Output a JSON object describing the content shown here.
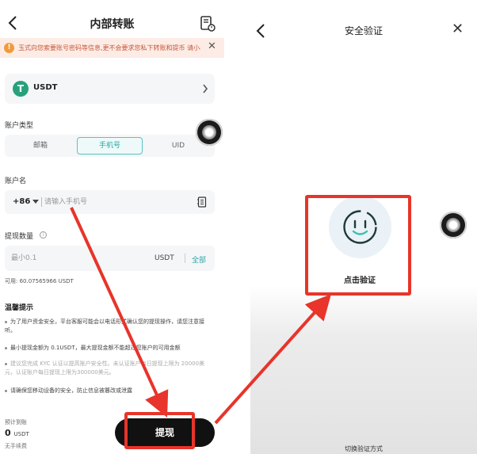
{
  "left": {
    "header": {
      "title": "内部转账",
      "back_icon": "chevron-left-icon",
      "records_icon": "records-icon"
    },
    "notice": {
      "text": "玉式向您索要账号密码等信息,更不会要求您私下转账和提币 请小心",
      "icon": "alert-icon"
    },
    "coin": {
      "name": "USDT",
      "logo_letter": "T",
      "brand_color": "#27a17c"
    },
    "account_type": {
      "label": "账户类型",
      "tabs": [
        {
          "label": "邮箱"
        },
        {
          "label": "手机号"
        },
        {
          "label": "UID"
        }
      ],
      "selected": "手机号"
    },
    "account_name": {
      "label": "账户名",
      "country_code": "+86",
      "placeholder": "请输入手机号",
      "value": ""
    },
    "amount": {
      "label": "提现数量",
      "placeholder": "最小0.1",
      "unit": "USDT",
      "all_label": "全部",
      "available": "可用: 60.07565966 USDT"
    },
    "tips": {
      "title": "温馨提示",
      "items": [
        "为了用户资金安全，平台客服可能会以电话形式确认您的提现操作，请您注意接听。",
        "最小提现金额为 0.1USDT，最大提现金额不能超过您账户的可用金额",
        "建议您完成 KYC 认证以提高账户安全性。未认证账户每日提现上限为 20000美元，认证账户每日提现上限为300000美元。",
        "请确保您移动设备的安全，防止信息被篡改或泄露"
      ]
    },
    "footer": {
      "estimate_label": "预计到账",
      "estimate_value": "0",
      "estimate_unit": "USDT",
      "fee_label": "无手续费",
      "withdraw_label": "提现"
    }
  },
  "right": {
    "header": {
      "title": "安全验证",
      "back_icon": "chevron-left-icon",
      "close_label": "✕"
    },
    "verify": {
      "icon": "face-scan-icon",
      "label": "点击验证"
    },
    "switch_label": "切换验证方式"
  },
  "colors": {
    "accent": "#2aa5a5",
    "highlight_red": "#e8342a",
    "button_dark": "#111111",
    "notice_bg": "#fdece6"
  }
}
